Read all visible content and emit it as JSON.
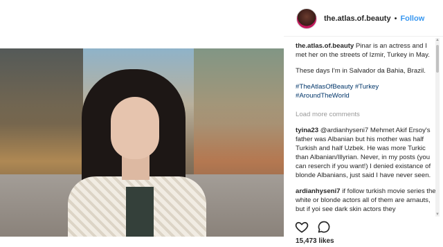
{
  "post": {
    "username": "the.atlas.of.beauty",
    "separator": "•",
    "follow_label": "Follow",
    "caption_user": "the.atlas.of.beauty",
    "caption_text": "Pinar is an actress and I met her on the streets of Izmir, Turkey in May.",
    "caption_line2": "These days I'm in Salvador da Bahia, Brazil.",
    "hashtags": [
      "#TheAtlasOfBeauty",
      "#Turkey",
      "#AroundTheWorld"
    ],
    "load_more_label": "Load more comments",
    "comments": [
      {
        "user": "tyina23",
        "text": "@ardianhyseni7 Mehmet Akif Ersoy's father was Albanian but his mother was half Turkish and half Uzbek. He was more Turkic than Albanian/Illyrian. Never, in my posts (you can reserch if you want!) I denied existance of blonde Albanians, just said I have never seen."
      },
      {
        "user": "ardianhyseni7",
        "text": "if follow turkish movie series the white or blonde actors all of them are arnauts, but if yoi see dark skin actors they"
      }
    ],
    "likes_label": "15,473 likes"
  },
  "icons": {
    "heart": "heart-icon",
    "comment": "comment-icon",
    "scroll_up": "scroll-up-icon",
    "scroll_down": "scroll-down-icon"
  },
  "colors": {
    "link": "#3897f0",
    "hashtag": "#003569",
    "muted": "#999999",
    "text": "#262626"
  }
}
